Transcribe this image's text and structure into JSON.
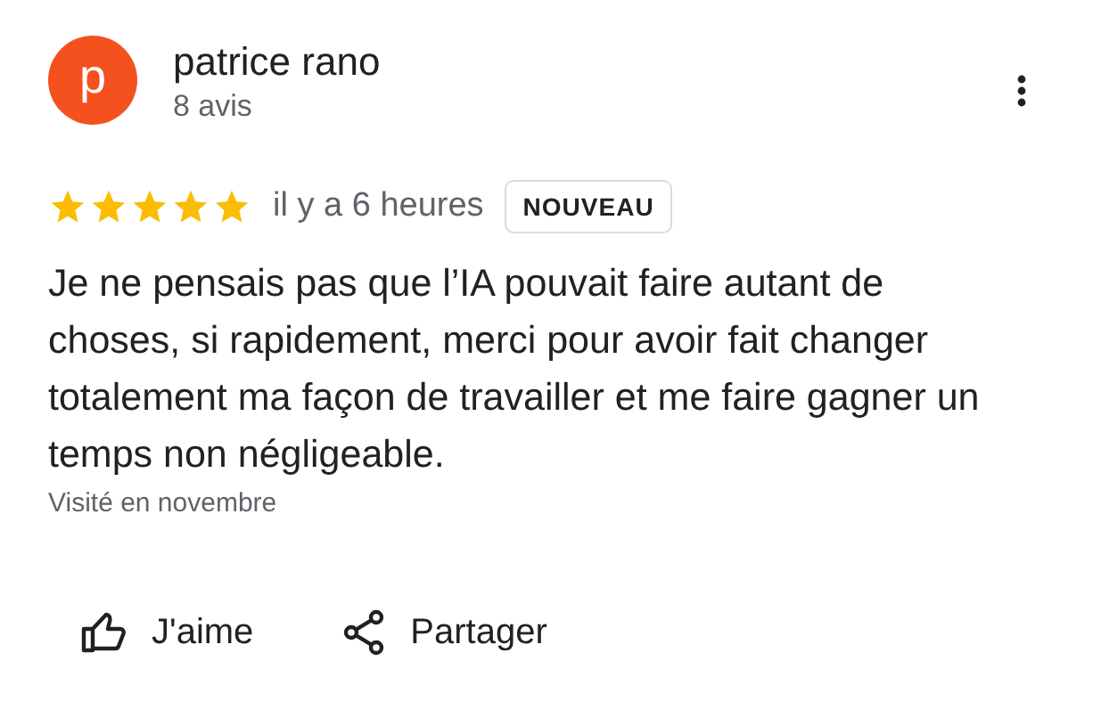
{
  "review": {
    "avatar_letter": "p",
    "author": "patrice rano",
    "review_count": "8 avis",
    "stars": 5,
    "time": "il y a 6 heures",
    "badge": "NOUVEAU",
    "text": "Je ne pensais pas que l’IA pouvait faire autant de choses, si rapidement, merci pour avoir fait changer totalement ma façon de travailler et me faire gagner un temps non négligeable.",
    "visited": "Visité en novembre"
  },
  "actions": [
    {
      "kind": "like",
      "label": "J'aime"
    },
    {
      "kind": "share",
      "label": "Partager"
    }
  ]
}
